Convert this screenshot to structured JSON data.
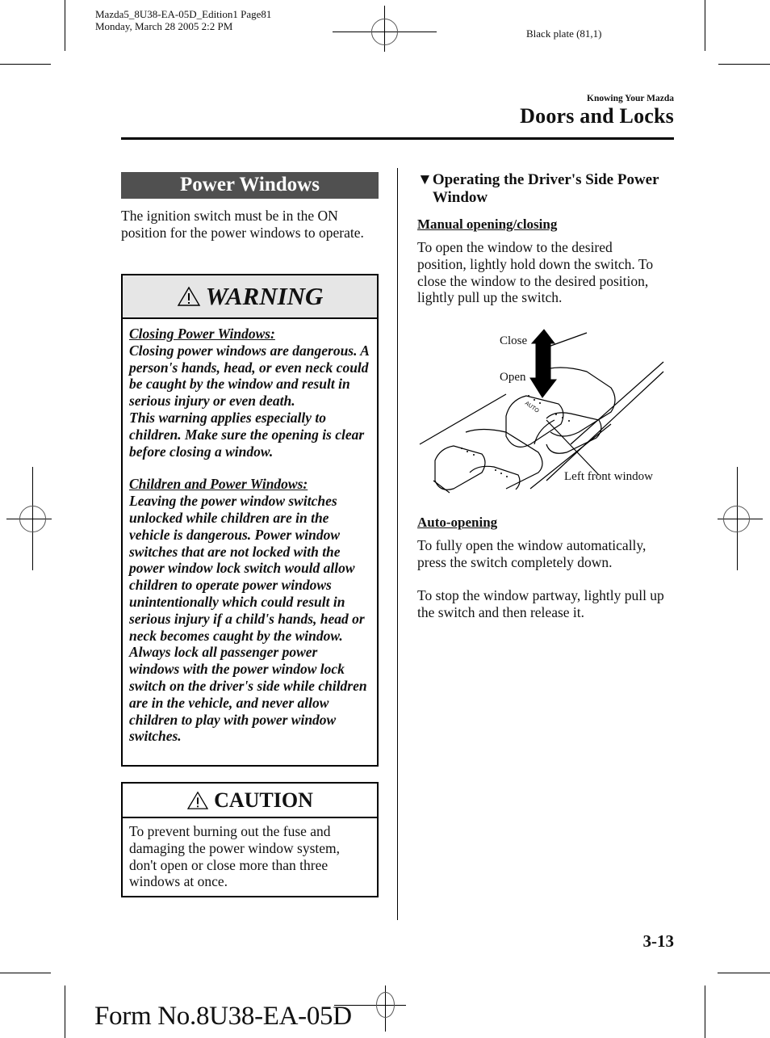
{
  "print_slug": {
    "line1": "Mazda5_8U38-EA-05D_Edition1 Page81",
    "line2": "Monday, March 28 2005 2:2 PM",
    "plate": "Black plate (81,1)"
  },
  "header": {
    "chapter": "Knowing Your Mazda",
    "section": "Doors and Locks"
  },
  "left_column": {
    "title": "Power Windows",
    "intro": "The ignition switch must be in the ON position for the power windows to operate.",
    "warning": {
      "icon": "warning-triangle-icon",
      "label": "WARNING",
      "blocks": [
        {
          "subtitle": "Closing Power Windows:",
          "paragraphs": [
            "Closing power windows are dangerous. A person's hands, head, or even neck could be caught by the window and result in serious injury or even death.",
            "This warning applies especially to children. Make sure the opening is clear before closing a window."
          ]
        },
        {
          "subtitle": "Children and Power Windows:",
          "paragraphs": [
            "Leaving the power window switches unlocked while children are in the vehicle is dangerous. Power window switches that are not locked with the power window lock switch would allow children to operate power windows unintentionally which could result in serious injury if a child's hands, head or neck becomes caught by the window. Always lock all passenger power windows with the power window lock switch on the driver's side while children are in the vehicle, and never allow children to play with power window switches."
          ]
        }
      ]
    },
    "caution": {
      "icon": "caution-triangle-icon",
      "label": "CAUTION",
      "text": "To prevent burning out the fuse and damaging the power window system, don't open or close more than three windows at once."
    }
  },
  "right_column": {
    "heading_marker": "▼",
    "heading": "Operating the Driver's Side Power Window",
    "manual": {
      "subtitle": "Manual opening/closing",
      "text": "To open the window to the desired position, lightly hold down the switch. To close the window to the desired position, lightly pull up the switch."
    },
    "figure": {
      "label_close": "Close",
      "label_open": "Open",
      "label_switch": "Left front window",
      "switch_text": "AUTO"
    },
    "auto": {
      "subtitle": "Auto-opening",
      "text1": "To fully open the window automatically, press the switch completely down.",
      "text2": "To stop the window partway, lightly pull up the switch and then release it."
    }
  },
  "footer": {
    "page_number": "3-13",
    "form_number": "Form No.8U38-EA-05D"
  }
}
